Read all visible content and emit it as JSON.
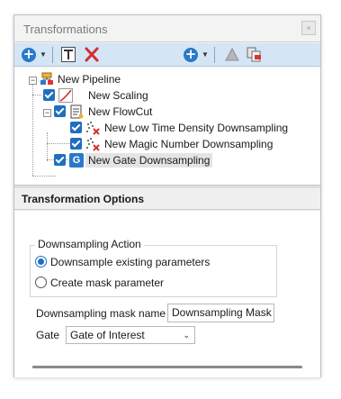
{
  "window": {
    "title": "Transformations",
    "close_glyph": "×"
  },
  "toolbar": {
    "add_icon": "plus-circle-icon",
    "text_icon": "text-box-icon",
    "delete_icon": "red-x-icon",
    "add_glyph": "+",
    "dropdown_glyph": "▼"
  },
  "tree": {
    "root": {
      "label": "New Pipeline",
      "expander": "−"
    },
    "items": [
      {
        "label": "New Scaling"
      },
      {
        "label": "New FlowCut",
        "expander": "−"
      },
      {
        "label": "New Low Time Density Downsampling"
      },
      {
        "label": "New Magic Number Downsampling"
      },
      {
        "label": "New Gate Downsampling",
        "icon_letter": "G"
      }
    ]
  },
  "options": {
    "header": "Transformation Options",
    "group_title": "Downsampling Action",
    "radio_1": "Downsample existing parameters",
    "radio_2": "Create mask parameter",
    "selected_radio": "radio_1",
    "mask_name_label": "Downsampling mask name",
    "mask_name_value": "Downsampling Mask",
    "gate_label": "Gate",
    "gate_value": "Gate of Interest",
    "gate_chevron": "⌄"
  },
  "colors": {
    "accent": "#1f6fbf",
    "toolbar_bg": "#d4e5f6",
    "delete_red": "#d32f2f"
  }
}
